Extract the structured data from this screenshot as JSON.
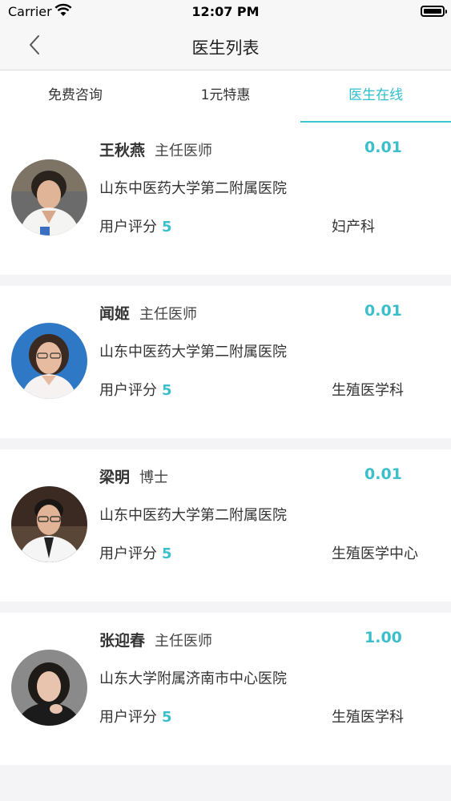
{
  "status": {
    "carrier": "Carrier",
    "time": "12:07 PM"
  },
  "nav": {
    "title": "医生列表"
  },
  "tabs": [
    {
      "label": "免费咨询",
      "active": false
    },
    {
      "label": "1元特惠",
      "active": false
    },
    {
      "label": "医生在线",
      "active": true
    }
  ],
  "rating_label": "用户评分",
  "doctors": [
    {
      "name": "王秋燕",
      "title": "主任医师",
      "price": "0.01",
      "hospital": "山东中医药大学第二附属医院",
      "score": "5",
      "department": "妇产科"
    },
    {
      "name": "闻姬",
      "title": "主任医师",
      "price": "0.01",
      "hospital": "山东中医药大学第二附属医院",
      "score": "5",
      "department": "生殖医学科"
    },
    {
      "name": "梁明",
      "title": "博士",
      "price": "0.01",
      "hospital": "山东中医药大学第二附属医院",
      "score": "5",
      "department": "生殖医学中心"
    },
    {
      "name": "张迎春",
      "title": "主任医师",
      "price": "1.00",
      "hospital": "山东大学附属济南市中心医院",
      "score": "5",
      "department": "生殖医学科"
    }
  ],
  "colors": {
    "accent": "#3cbfcb",
    "background": "#f4f4f6"
  }
}
